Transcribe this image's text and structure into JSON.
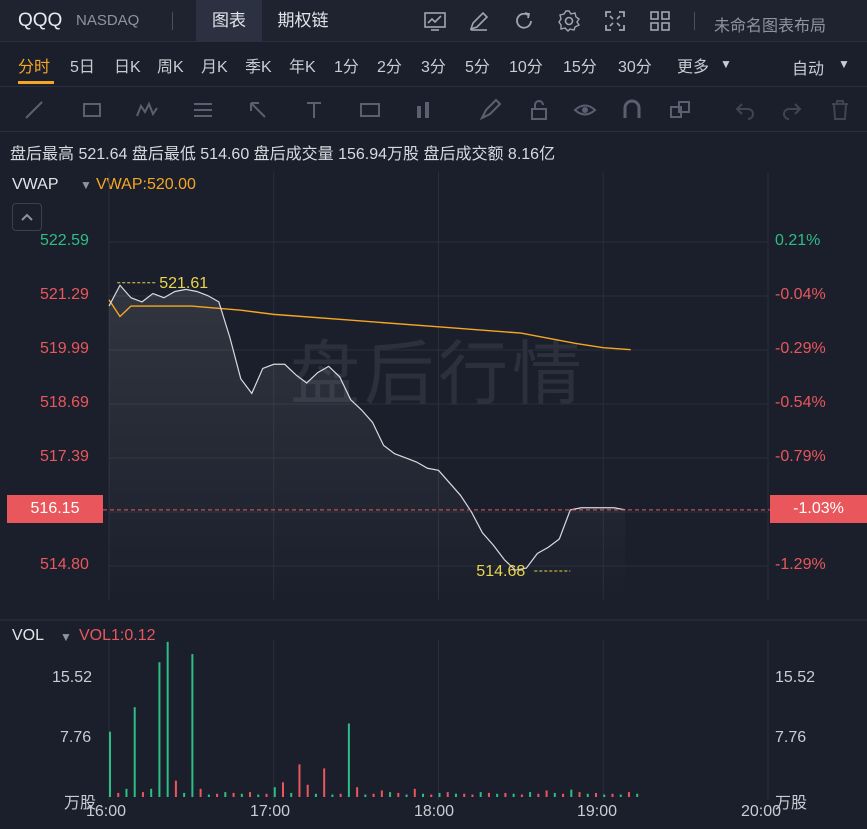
{
  "header": {
    "symbol": "QQQ",
    "exchange": "NASDAQ",
    "tabs": [
      {
        "label": "图表"
      },
      {
        "label": "期权链"
      }
    ],
    "layout_name": "未命名图表布局",
    "icons": [
      "chart-trend-icon",
      "pencil-icon",
      "refresh-icon",
      "settings-icon",
      "fullscreen-icon",
      "grid-layout-icon"
    ]
  },
  "periods": {
    "items": [
      "分时",
      "5日",
      "日K",
      "周K",
      "月K",
      "季K",
      "年K",
      "1分",
      "2分",
      "3分",
      "5分",
      "10分",
      "15分",
      "30分",
      "更多"
    ],
    "active": "分时",
    "scale_mode": "自动"
  },
  "draw_tools": [
    "line-tool-icon",
    "rect-tool-icon",
    "pattern-tool-icon",
    "fib-tool-icon",
    "arrow-tool-icon",
    "text-tool-icon",
    "label-tool-icon",
    "position-tool-icon",
    "brush-tool-icon",
    "lock-icon",
    "eye-icon",
    "magnet-icon",
    "layers-icon",
    "undo-icon",
    "redo-icon",
    "trash-icon"
  ],
  "stats": {
    "text": "盘后最高 521.64 盘后最低 514.60 盘后成交量 156.94万股 盘后成交额 8.16亿"
  },
  "main_panel": {
    "indicator_name": "VWAP",
    "indicator_value": "VWAP:520.00",
    "watermark": "盘后行情",
    "current_price": "516.15",
    "current_pct": "-1.03%",
    "high_label": "521.61",
    "low_label": "514.68",
    "left_axis": [
      "522.59",
      "521.29",
      "519.99",
      "518.69",
      "517.39",
      "514.80"
    ],
    "right_axis": [
      "0.21%",
      "-0.04%",
      "-0.29%",
      "-0.54%",
      "-0.79%",
      "-1.29%"
    ],
    "colors": {
      "up": "#2ebd85",
      "down": "#e9575d",
      "vwap": "#f5a623",
      "price": "#d8dae0"
    }
  },
  "volume_panel": {
    "indicator_name": "VOL",
    "indicator_value": "VOL1:0.12",
    "left_axis": [
      "15.52",
      "7.76",
      "万股"
    ],
    "right_axis": [
      "15.52",
      "7.76",
      "万股"
    ]
  },
  "x_axis": [
    "16:00",
    "17:00",
    "18:00",
    "19:00",
    "20:00"
  ],
  "chart_data": {
    "type": "line",
    "x_range": [
      "16:00",
      "20:00"
    ],
    "ylim": [
      514.8,
      522.59
    ],
    "price_series": {
      "x": [
        "16:00",
        "16:04",
        "16:08",
        "16:12",
        "16:16",
        "16:20",
        "16:24",
        "16:28",
        "16:32",
        "16:36",
        "16:40",
        "16:44",
        "16:48",
        "16:52",
        "16:56",
        "17:00",
        "17:04",
        "17:08",
        "17:12",
        "17:16",
        "17:20",
        "17:24",
        "17:28",
        "17:32",
        "17:36",
        "17:40",
        "17:44",
        "17:48",
        "17:52",
        "17:56",
        "18:00",
        "18:04",
        "18:08",
        "18:12",
        "18:16",
        "18:20",
        "18:24",
        "18:28",
        "18:32",
        "18:36",
        "18:40",
        "18:44",
        "18:48",
        "18:52",
        "18:56",
        "19:00",
        "19:04",
        "19:08"
      ],
      "y": [
        521.05,
        521.55,
        521.25,
        521.15,
        521.35,
        521.25,
        521.4,
        521.45,
        521.4,
        521.3,
        521.15,
        520.3,
        519.3,
        518.95,
        519.55,
        519.65,
        519.65,
        519.4,
        519.2,
        519.45,
        519.6,
        519.35,
        518.8,
        518.55,
        518.25,
        517.7,
        517.5,
        517.4,
        517.3,
        517.15,
        517.1,
        516.8,
        516.5,
        516.1,
        515.6,
        515.3,
        514.95,
        514.7,
        514.75,
        515.1,
        515.25,
        515.45,
        516.15,
        516.2,
        516.2,
        516.2,
        516.2,
        516.15
      ],
      "low_marker": 514.68,
      "high_marker": 521.61
    },
    "vwap_series": {
      "x": [
        "16:00",
        "16:04",
        "16:08",
        "16:16",
        "16:30",
        "16:48",
        "17:00",
        "17:30",
        "18:00",
        "18:30",
        "18:50",
        "19:00",
        "19:10"
      ],
      "y": [
        521.2,
        520.8,
        521.05,
        521.05,
        521.05,
        520.95,
        520.85,
        520.7,
        520.55,
        520.4,
        520.15,
        520.05,
        520.0
      ]
    },
    "volume_bars": {
      "ylim": [
        0,
        18
      ],
      "unit": "万股",
      "x_minutes": [
        0,
        3,
        6,
        9,
        12,
        15,
        18,
        21,
        24,
        27,
        30,
        33,
        36,
        39,
        42,
        45,
        48,
        51,
        54,
        57,
        60,
        63,
        66,
        69,
        72,
        75,
        78,
        81,
        84,
        87,
        90,
        93,
        96,
        99,
        102,
        105,
        108,
        111,
        114,
        117,
        120,
        123,
        126,
        129,
        132,
        135,
        138,
        141,
        144,
        147,
        150,
        153,
        156,
        159,
        162,
        165,
        168,
        171,
        174,
        177,
        180,
        183,
        186,
        189,
        192
      ],
      "values": [
        8,
        0.5,
        1,
        11,
        0.6,
        1,
        16.5,
        19,
        2,
        0.5,
        17.5,
        1,
        0.3,
        0.4,
        0.6,
        0.5,
        0.4,
        0.6,
        0.3,
        0.4,
        1.2,
        1.8,
        0.5,
        4,
        1.5,
        0.4,
        3.5,
        0.3,
        0.4,
        9,
        1.2,
        0.3,
        0.4,
        0.8,
        0.6,
        0.5,
        0.3,
        1,
        0.4,
        0.3,
        0.5,
        0.6,
        0.4,
        0.4,
        0.3,
        0.6,
        0.5,
        0.4,
        0.5,
        0.4,
        0.3,
        0.6,
        0.4,
        0.8,
        0.5,
        0.4,
        0.9,
        0.6,
        0.4,
        0.5,
        0.3,
        0.4,
        0.3,
        0.6,
        0.4
      ],
      "directions": [
        "up",
        "down",
        "up",
        "up",
        "down",
        "up",
        "up",
        "up",
        "down",
        "up",
        "up",
        "down",
        "up",
        "down",
        "up",
        "down",
        "up",
        "down",
        "up",
        "down",
        "up",
        "down",
        "up",
        "down",
        "down",
        "up",
        "down",
        "up",
        "down",
        "up",
        "down",
        "up",
        "down",
        "down",
        "up",
        "down",
        "up",
        "down",
        "up",
        "down",
        "up",
        "down",
        "up",
        "down",
        "down",
        "up",
        "down",
        "up",
        "down",
        "up",
        "down",
        "up",
        "down",
        "down",
        "up",
        "down",
        "up",
        "down",
        "up",
        "down",
        "up",
        "down",
        "up",
        "down",
        "up"
      ]
    }
  }
}
